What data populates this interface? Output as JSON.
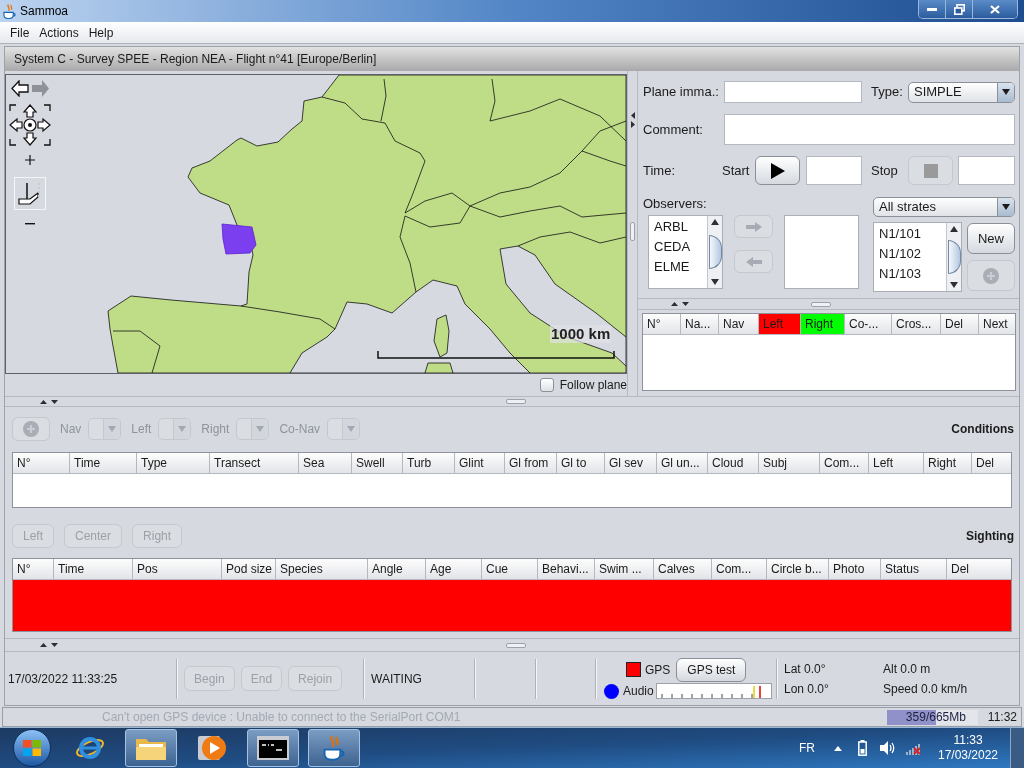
{
  "window": {
    "title": "Sammoa"
  },
  "menu": [
    {
      "label": "File"
    },
    {
      "label": "Actions"
    },
    {
      "label": "Help"
    }
  ],
  "frame": {
    "title": "System C - Survey SPEE - Region NEA - Flight n°41 [Europe/Berlin]"
  },
  "map": {
    "scale_label": "1000 km",
    "follow_plane": {
      "label": "Follow plane",
      "checked": false
    }
  },
  "flight": {
    "plane_label": "Plane imma.:",
    "type_label": "Type:",
    "type_value": "SIMPLE",
    "comment_label": "Comment:",
    "time_label": "Time:",
    "start": {
      "label": "Start",
      "disabled": false
    },
    "stop": {
      "label": "Stop",
      "disabled": true
    },
    "observers": {
      "label": "Observers:",
      "available": [
        "ARBL",
        "CEDA",
        "ELME"
      ],
      "buttons": [
        {
          "kind": "add",
          "disabled": true
        },
        {
          "kind": "remove",
          "disabled": true
        }
      ]
    },
    "strates": {
      "filter": "All strates",
      "items": [
        "N1/101",
        "N1/102",
        "N1/103"
      ],
      "new_button": {
        "label": "New",
        "disabled": false
      },
      "add_button": {
        "disabled": true
      }
    }
  },
  "transects": {
    "columns": [
      {
        "label": "N°"
      },
      {
        "label": "Na..."
      },
      {
        "label": "Nav"
      },
      {
        "label": "Left",
        "color": "#ff0000"
      },
      {
        "label": "Right",
        "color": "#00ff00"
      },
      {
        "label": "Co-..."
      },
      {
        "label": "Cros..."
      },
      {
        "label": "Del"
      },
      {
        "label": "Next"
      }
    ]
  },
  "conditions": {
    "title": "Conditions",
    "add_button": {
      "disabled": true
    },
    "selectors": [
      {
        "label": "Nav",
        "disabled": true
      },
      {
        "label": "Left",
        "disabled": true
      },
      {
        "label": "Right",
        "disabled": true
      },
      {
        "label": "Co-Nav",
        "disabled": true
      }
    ],
    "columns": [
      {
        "label": "N°"
      },
      {
        "label": "Time"
      },
      {
        "label": "Type"
      },
      {
        "label": "Transect"
      },
      {
        "label": "Sea"
      },
      {
        "label": "Swell"
      },
      {
        "label": "Turb"
      },
      {
        "label": "Glint"
      },
      {
        "label": "Gl from"
      },
      {
        "label": "Gl to"
      },
      {
        "label": "Gl sev"
      },
      {
        "label": "Gl un..."
      },
      {
        "label": "Cloud"
      },
      {
        "label": "Subj"
      },
      {
        "label": "Com..."
      },
      {
        "label": "Left"
      },
      {
        "label": "Right"
      },
      {
        "label": "Del"
      }
    ]
  },
  "sighting": {
    "title": "Sighting",
    "buttons": [
      {
        "label": "Left",
        "disabled": true
      },
      {
        "label": "Center",
        "disabled": true
      },
      {
        "label": "Right",
        "disabled": true
      }
    ],
    "columns": [
      {
        "label": "N°"
      },
      {
        "label": "Time"
      },
      {
        "label": "Pos"
      },
      {
        "label": "Pod size"
      },
      {
        "label": "Species"
      },
      {
        "label": "Angle"
      },
      {
        "label": "Age"
      },
      {
        "label": "Cue"
      },
      {
        "label": "Behavi..."
      },
      {
        "label": "Swim ..."
      },
      {
        "label": "Calves"
      },
      {
        "label": "Com..."
      },
      {
        "label": "Circle b..."
      },
      {
        "label": "Photo"
      },
      {
        "label": "Status"
      },
      {
        "label": "Del"
      }
    ],
    "highlighted": true
  },
  "status_panel": {
    "datetime": "17/03/2022 11:33:25",
    "buttons": [
      {
        "label": "Begin",
        "disabled": true
      },
      {
        "label": "End",
        "disabled": true
      },
      {
        "label": "Rejoin",
        "disabled": true
      }
    ],
    "state": "WAITING",
    "indicators": [
      {
        "kind": "square",
        "label": "GPS",
        "color": "#ff0000"
      },
      {
        "kind": "circle",
        "label": "Audio",
        "color": "#0000ff"
      }
    ],
    "gps_test": "GPS test",
    "lat": "Lat 0.0°",
    "lon": "Lon 0.0°",
    "alt": "Alt 0.0 m",
    "speed": "Speed 0.0 km/h"
  },
  "status_bar": {
    "message": "Can't open GPS device : Unable to connect to the SerialPort COM1",
    "memory": {
      "text": "359/665Mb",
      "level": 0.54
    },
    "time": "11:32"
  },
  "taskbar": {
    "apps": [
      {
        "kind": "browser",
        "running": false
      },
      {
        "kind": "folder",
        "running": true
      },
      {
        "kind": "media",
        "running": false
      },
      {
        "kind": "terminal",
        "running": true
      },
      {
        "kind": "java",
        "running": true
      }
    ],
    "language": "FR",
    "clock": {
      "time": "11:33",
      "date": "17/03/2022"
    }
  }
}
